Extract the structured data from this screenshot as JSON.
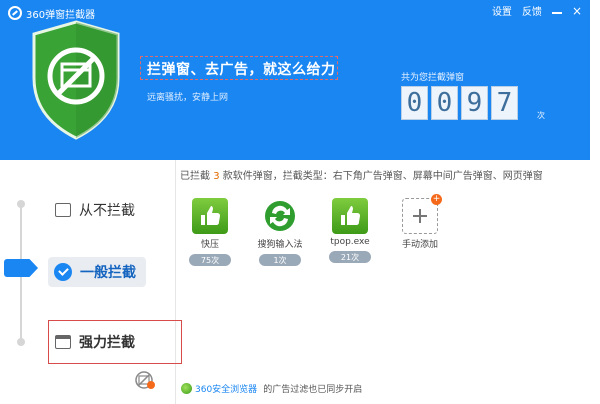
{
  "window": {
    "title": "360弹窗拦截器",
    "settings_label": "设置",
    "feedback_label": "反馈"
  },
  "header": {
    "slogan": "拦弹窗、去广告，就这么给力",
    "subslogan": "远离骚扰，安静上网",
    "counter_label": "共为您拦截弹窗",
    "counter_digits": [
      "0",
      "0",
      "9",
      "7"
    ],
    "counter_unit": "次"
  },
  "modes": {
    "never": "从不拦截",
    "normal": "一般拦截",
    "strong": "强力拦截",
    "active": "normal"
  },
  "summary": {
    "prefix": "已拦截",
    "count": "3",
    "suffix": "款软件弹窗，拦截类型：右下角广告弹窗、屏幕中间广告弹窗、网页弹窗"
  },
  "apps": [
    {
      "name": "快压",
      "count": "75次",
      "icon": "thumbs-up-icon"
    },
    {
      "name": "搜狗输入法",
      "count": "1次",
      "icon": "sogou-icon"
    },
    {
      "name": "tpop.exe",
      "count": "21次",
      "icon": "thumbs-up-icon"
    },
    {
      "name": "手动添加",
      "count": "",
      "icon": "add-icon"
    }
  ],
  "footer": {
    "browser_name": "360安全浏览器",
    "text": "的广告过滤也已同步开启"
  },
  "colors": {
    "header_blue": "#1a86f2",
    "accent_orange": "#e36a00",
    "shield_green": "#4cb43c"
  }
}
